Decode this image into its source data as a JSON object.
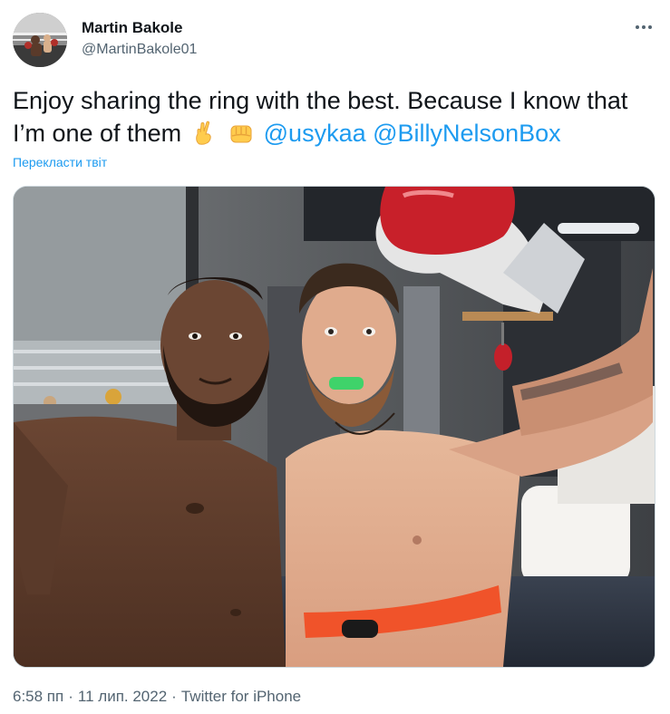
{
  "tweet": {
    "author": {
      "display_name": "Martin Bakole",
      "handle": "@MartinBakole01",
      "avatar_icon": "boxing-ring-avatar"
    },
    "more_icon": "more-dots-icon",
    "text_parts": {
      "main": "Enjoy sharing the ring with the best. Because I know that I’m one of them",
      "emoji_1": "crossed-fingers-emoji",
      "emoji_2": "oncoming-fist-emoji",
      "mention_1": "@usykaa",
      "mention_2": "@BillyNelsonBox"
    },
    "translate_label": "Перекласти твіт",
    "meta": {
      "time": "6:58 пп",
      "separator": "·",
      "date": "11 лип. 2022",
      "source": "Twitter for iPhone"
    }
  },
  "colors": {
    "accent": "#1d9bf0",
    "text_primary": "#0f1419",
    "text_secondary": "#536471",
    "border": "#cfd9de"
  }
}
